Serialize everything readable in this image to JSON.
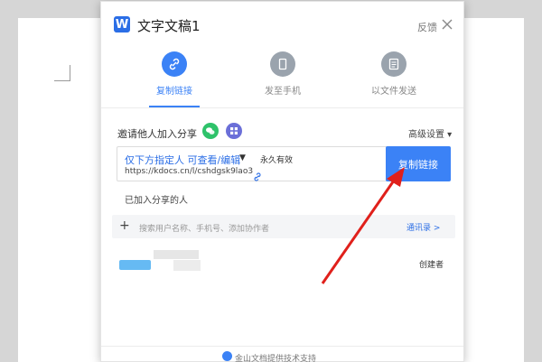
{
  "dialog": {
    "title": "文字文稿1",
    "feedback": "反馈"
  },
  "modes": [
    {
      "label": "复制链接",
      "icon": "link-icon"
    },
    {
      "label": "发至手机",
      "icon": "phone-icon"
    },
    {
      "label": "以文件发送",
      "icon": "file-icon"
    }
  ],
  "invite": {
    "label": "邀请他人加入分享",
    "advanced": "高级设置 ▾"
  },
  "link": {
    "permission": "仅下方指定人 可查看/编辑",
    "caret": "▼",
    "validity": "永久有效",
    "url": "https://kdocs.cn/l/cshdgsk9lao3",
    "copy_button": "复制链接"
  },
  "members": {
    "joined_label": "已加入分享的人",
    "search_placeholder": "搜索用户名称、手机号、添加协作者",
    "contacts": "通讯录 >",
    "owner_role": "创建者"
  },
  "footer": {
    "text": "金山文档提供技术支持"
  },
  "colors": {
    "accent": "#3b82f6",
    "annotation_arrow": "#e0201b"
  }
}
